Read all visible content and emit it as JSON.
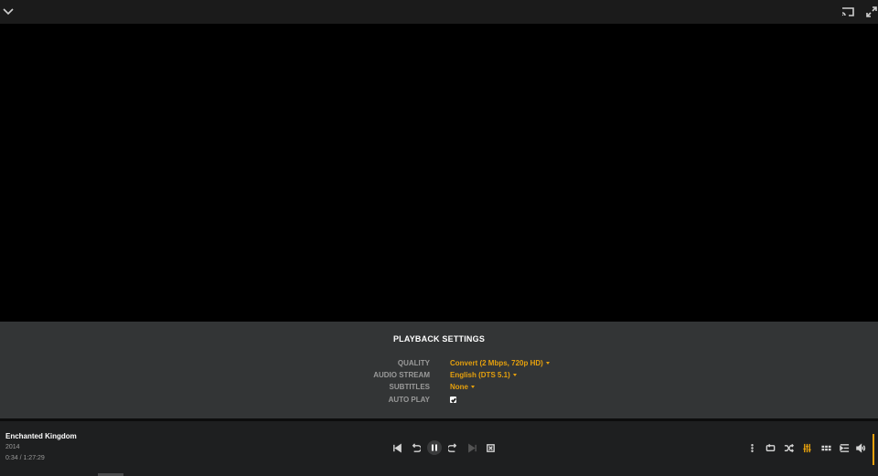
{
  "topbar": {
    "collapse_icon": "chevron-down-icon",
    "cast_icon": "cast-icon",
    "fullscreen_icon": "fullscreen-icon"
  },
  "settings": {
    "title": "PLAYBACK SETTINGS",
    "rows": [
      {
        "label": "QUALITY",
        "value": "Convert (2 Mbps, 720p HD)"
      },
      {
        "label": "AUDIO STREAM",
        "value": "English (DTS 5.1)"
      },
      {
        "label": "SUBTITLES",
        "value": "None"
      },
      {
        "label": "AUTO PLAY",
        "checked": true
      }
    ]
  },
  "now_playing": {
    "title": "Enchanted Kingdom",
    "year": "2014",
    "time": "0:34 / 1:27:29"
  },
  "colors": {
    "accent": "#e5a00d",
    "panel": "#333536",
    "bar": "#1e1f20"
  },
  "progress": {
    "fraction": 0.0065
  }
}
